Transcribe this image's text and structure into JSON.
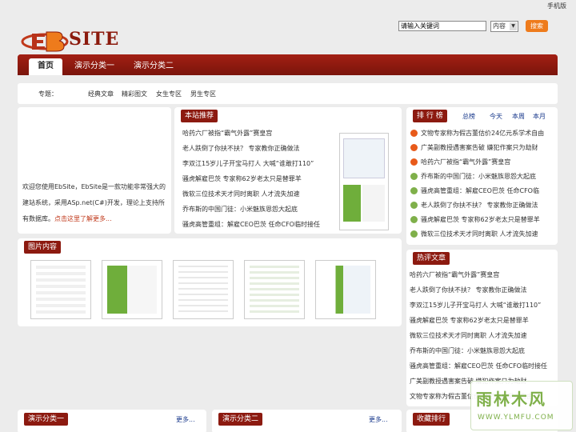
{
  "header": {
    "mobile_link": "手机版",
    "logo_text": "SITE",
    "search_placeholder": "请输入关键词",
    "search_scope": "内容",
    "search_button": "搜索"
  },
  "nav": {
    "tabs": [
      {
        "label": "首页",
        "active": true
      },
      {
        "label": "演示分类一"
      },
      {
        "label": "演示分类二"
      }
    ]
  },
  "topics": {
    "label": "专题：",
    "items": [
      "经典文章",
      "精彩图文",
      "女生专区",
      "男生专区"
    ]
  },
  "intro": {
    "text_line1": "欢迎您使用EbSite，EbSite是一款功能非常强大的",
    "text_line2": "建站系统，采用ASp.net(C#)开发，理论上支持所",
    "text_line3": "有数据库。",
    "link": "点击这里了解更多..."
  },
  "recommend": {
    "title": "本站推荐",
    "items": [
      "哈药六厂被指“霸气外露”赛皇宫",
      "老人跌倒了你扶不扶？ 专家教你正确做法",
      "李双江15岁儿子开宝马打人 大喊“谁敢打110”",
      "骚虎解雇巴茨 专家称62岁老太只是替罪羊",
      "微软三位技术天才同时离职 人才流失加速",
      "乔布斯的中国门徒：小米魅族恩怨大起底",
      "骚虎高管重组：解雇CEO巴茨 任命CFO临时接任"
    ]
  },
  "ranking": {
    "title": "排 行 榜",
    "tabs": [
      "总榜",
      "今天",
      "本周",
      "本月"
    ],
    "items": [
      "文物专家称为假古董估价24亿元系学术自由",
      "广美副教授遇害案告破 嫌犯作案只为劫财",
      "哈药六厂被指“霸气外露”赛皇宫",
      "乔布斯的中国门徒：小米魅族恩怨大起底",
      "骚虎高管重组：解雇CEO巴茨 任命CFO临",
      "老人跌倒了你扶不扶？ 专家教你正确做法",
      "骚虎解雇巴茨 专家称62岁老太只是替罪羊",
      "微软三位技术天才同时离职 人才流失加速"
    ]
  },
  "pictures": {
    "title": "图片内容"
  },
  "hot": {
    "title": "热评文章",
    "items": [
      "哈药六厂被指“霸气外露”赛皇宫",
      "老人跌倒了你扶不扶？ 专家教你正确做法",
      "李双江15岁儿子开宝马打人 大喊“谁敢打110”",
      "骚虎解雇巴茨 专家称62岁老太只是替罪羊",
      "微软三位技术天才同时离职 人才流失加速",
      "乔布斯的中国门徒：小米魅族恩怨大起底",
      "骚虎高管重组：解雇CEO巴茨 任命CFO临时接任",
      "广美副教授遇害案告破 嫌犯作案只为劫财",
      "文物专家称为假古董估价24亿元系学术自由"
    ]
  },
  "bottom": {
    "cat1": "演示分类一",
    "cat2": "演示分类二",
    "more": "更多...",
    "fav": "收藏排行"
  },
  "watermark": {
    "name": "雨林木风",
    "url": "WWW.YLMFU.COM"
  }
}
